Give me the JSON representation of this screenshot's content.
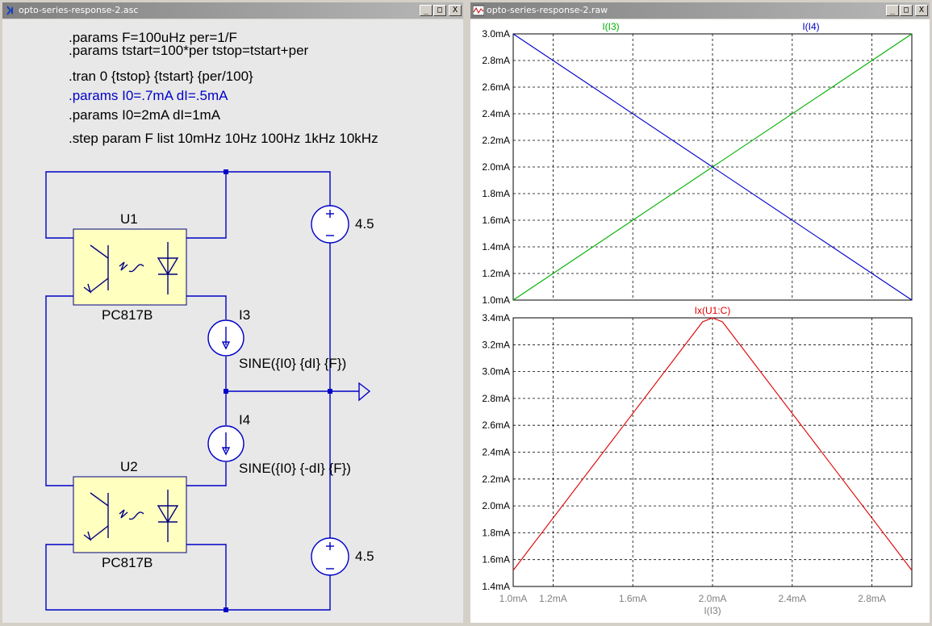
{
  "schematic_window": {
    "title": "opto-series-response-2.asc",
    "directives": [
      {
        "text": ".params F=100uHz per=1/F",
        "color": "#000000"
      },
      {
        "text": ".params tstart=100*per tstop=tstart+per",
        "color": "#000000"
      },
      {
        "text": ".tran 0 {tstop} {tstart} {per/100}",
        "color": "#000000"
      },
      {
        "text": ".params I0=.7mA dI=.5mA",
        "color": "#0000c8"
      },
      {
        "text": ".params I0=2mA dI=1mA",
        "color": "#000000"
      },
      {
        "text": ".step param F list 10mHz 10Hz 100Hz 1kHz 10kHz",
        "color": "#000000"
      }
    ],
    "components": {
      "u1_name": "U1",
      "u1_model": "PC817B",
      "u2_name": "U2",
      "u2_model": "PC817B",
      "v_top_value": "4.5",
      "v_bottom_value": "4.5",
      "i3_name": "I3",
      "i3_value": "SINE({I0} {dI} {F})",
      "i4_name": "I4",
      "i4_value": "SINE({I0} {-dI} {F})"
    }
  },
  "waveform_window": {
    "title": "opto-series-response-2.raw"
  },
  "buttons": {
    "minimize": "_",
    "maximize": "□",
    "close": "X"
  },
  "colors": {
    "green": "#00b000",
    "blue": "#0000c8",
    "red": "#e00000",
    "wire": "#0000c8"
  },
  "chart_data": [
    {
      "type": "line",
      "xlabel": "I(I3)",
      "xlim": [
        1.0,
        3.0
      ],
      "x_ticks": [
        "1.0mA",
        "1.2mA",
        "1.6mA",
        "2.0mA",
        "2.4mA",
        "2.8mA"
      ],
      "x_tick_values": [
        1.0,
        1.2,
        1.6,
        2.0,
        2.4,
        2.8
      ],
      "ylim": [
        1.0,
        3.0
      ],
      "y_ticks": [
        "1.0mA",
        "1.2mA",
        "1.4mA",
        "1.6mA",
        "1.8mA",
        "2.0mA",
        "2.2mA",
        "2.4mA",
        "2.6mA",
        "2.8mA",
        "3.0mA"
      ],
      "grid": true,
      "series": [
        {
          "name": "I(I3)",
          "color": "#00b000",
          "x": [
            1.0,
            3.0
          ],
          "y": [
            1.0,
            3.0
          ]
        },
        {
          "name": "I(I4)",
          "color": "#0000c8",
          "x": [
            1.0,
            3.0
          ],
          "y": [
            3.0,
            1.0
          ]
        }
      ]
    },
    {
      "type": "line",
      "xlabel": "I(I3)",
      "xlim": [
        1.0,
        3.0
      ],
      "ylim": [
        1.4,
        3.4
      ],
      "y_ticks": [
        "1.4mA",
        "1.6mA",
        "1.8mA",
        "2.0mA",
        "2.2mA",
        "2.4mA",
        "2.6mA",
        "2.8mA",
        "3.0mA",
        "3.2mA",
        "3.4mA"
      ],
      "grid": true,
      "series": [
        {
          "name": "Ix(U1:C)",
          "color": "#e00000",
          "x": [
            1.0,
            1.95,
            2.0,
            2.05,
            3.0
          ],
          "y": [
            1.52,
            3.37,
            3.4,
            3.37,
            1.52
          ]
        }
      ]
    }
  ]
}
